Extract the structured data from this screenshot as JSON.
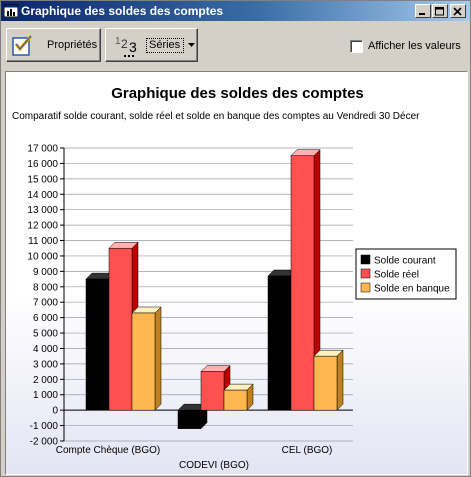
{
  "window": {
    "title": "Graphique des soldes des comptes",
    "icon": "chart-window-icon"
  },
  "toolbar": {
    "properties_label": "Propriétés",
    "series_label": "Séries",
    "show_values_label": "Afficher les valeurs",
    "show_values_checked": false
  },
  "chart_data": {
    "type": "bar",
    "title": "Graphique des soldes des comptes",
    "subtitle": "Comparatif solde courant, solde réel et solde en banque des comptes au Vendredi 30 Décer",
    "categories": [
      "Compte Chèque (BGO)",
      "CODEVI (BGO)",
      "CEL (BGO)"
    ],
    "series": [
      {
        "name": "Solde courant",
        "values": [
          8500,
          -1200,
          8700
        ],
        "color": "#000000",
        "side": "#000000",
        "top": "#333333"
      },
      {
        "name": "Solde réel",
        "values": [
          10500,
          2500,
          16500
        ],
        "color": "#ff5050",
        "side": "#c00000",
        "top": "#ffb0b0"
      },
      {
        "name": "Solde en banque",
        "values": [
          6300,
          1300,
          3500
        ],
        "color": "#ffb850",
        "side": "#c08020",
        "top": "#fff0c0"
      }
    ],
    "yticks": [
      "17 000",
      "16 000",
      "15 000",
      "14 000",
      "13 000",
      "12 000",
      "11 000",
      "10 000",
      "9 000",
      "8 000",
      "7 000",
      "6 000",
      "5 000",
      "4 000",
      "3 000",
      "2 000",
      "1 000",
      "0",
      "-1 000",
      "-2 000"
    ],
    "ylim": [
      -2000,
      17000
    ],
    "grid": true,
    "legend_position": "right"
  }
}
